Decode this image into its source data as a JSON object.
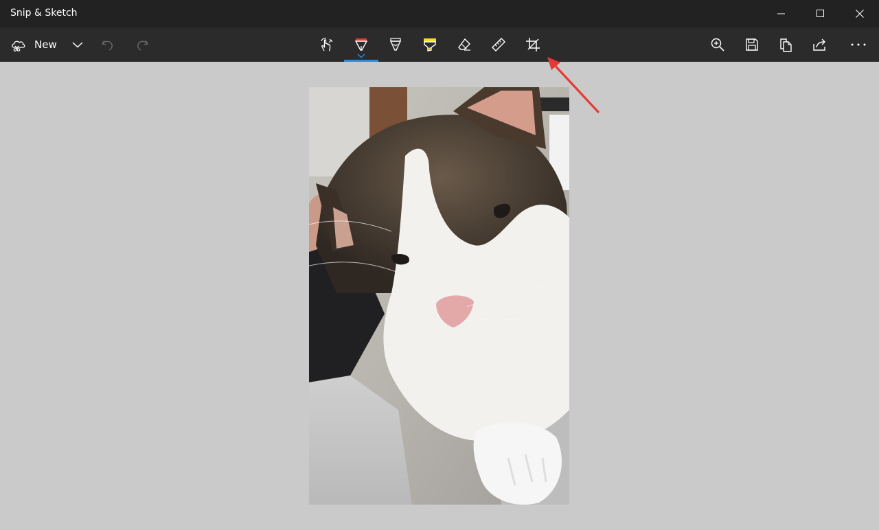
{
  "window": {
    "title": "Snip & Sketch",
    "controls": [
      "minimize-icon",
      "maximize-icon",
      "close-icon"
    ]
  },
  "toolbar": {
    "new_label": "New",
    "left_icons": [
      "new-snip-icon",
      "chevron-down-icon",
      "undo-icon",
      "redo-icon"
    ],
    "tools": [
      "touch-writing-icon",
      "ballpoint-pen-icon",
      "pencil-icon",
      "highlighter-icon",
      "eraser-icon",
      "ruler-icon",
      "image-crop-icon"
    ],
    "active_tool": "ballpoint-pen-icon",
    "right_icons": [
      "zoom-icon",
      "save-icon",
      "copy-icon",
      "share-icon",
      "more-icon"
    ]
  },
  "colors": {
    "titlebar": "#222222",
    "toolbar": "#2b2b2b",
    "canvas": "#cacaca",
    "accent": "#2d8bdc",
    "pen_tip": "#e53935",
    "highlighter": "#f4e01f",
    "annotation_arrow": "#e53935"
  },
  "canvas": {
    "content": "photo of a tabby-and-white cat"
  }
}
